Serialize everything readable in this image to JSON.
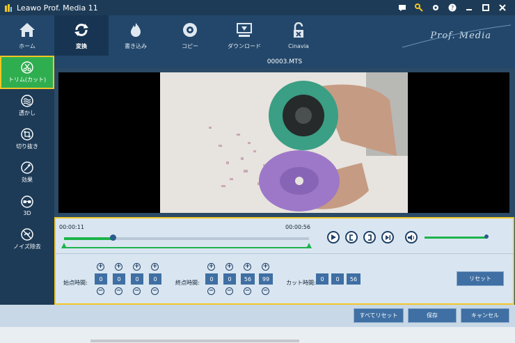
{
  "window": {
    "title": "Leawo Prof. Media 11",
    "controls": [
      "chat-icon",
      "key-icon",
      "gear-icon",
      "help-icon",
      "minimize-icon",
      "maximize-icon",
      "close-icon"
    ]
  },
  "toolbar": {
    "items": [
      {
        "label": "ホーム",
        "icon": "home-icon"
      },
      {
        "label": "変換",
        "icon": "convert-icon",
        "active": true
      },
      {
        "label": "書き込み",
        "icon": "burn-icon"
      },
      {
        "label": "コピー",
        "icon": "copy-disc-icon"
      },
      {
        "label": "ダウンロード",
        "icon": "download-icon"
      },
      {
        "label": "Cinavia",
        "icon": "cinavia-lock-icon"
      }
    ],
    "brand": "Prof. Media"
  },
  "sidebar": {
    "items": [
      {
        "label": "トリム(カット)",
        "icon": "scissors-icon",
        "active": true
      },
      {
        "label": "透かし",
        "icon": "watermark-icon"
      },
      {
        "label": "切り抜き",
        "icon": "crop-icon"
      },
      {
        "label": "効果",
        "icon": "effect-icon"
      },
      {
        "label": "3D",
        "icon": "3d-glasses-icon"
      },
      {
        "label": "ノイズ除去",
        "icon": "noise-removal-icon"
      }
    ]
  },
  "file": {
    "name": "00003.MTS"
  },
  "player": {
    "current_time": "00:00:11",
    "end_time": "00:00:56",
    "progress": 0.2,
    "volume": 1.0
  },
  "trim": {
    "start_label": "始点時間:",
    "start_values": [
      "0",
      "0",
      "0",
      "0"
    ],
    "end_label": "終点時間:",
    "end_values": [
      "0",
      "0",
      "56",
      "99"
    ],
    "cut_label": "カット時間:",
    "cut_values": [
      "0",
      "0",
      "56"
    ],
    "reset_label": "リセット"
  },
  "bottom": {
    "reset_all_label": "すべてリセット",
    "save_label": "保存",
    "cancel_label": "キャンセル"
  },
  "colors": {
    "accent_green": "#1db34b",
    "highlight_yellow": "#f3c623",
    "button_blue": "#3f6fa3"
  }
}
